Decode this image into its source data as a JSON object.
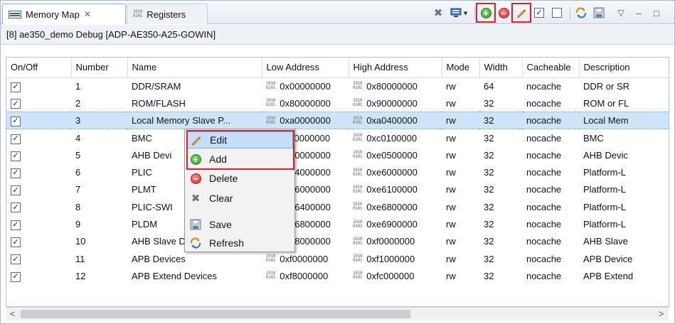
{
  "tabs": [
    {
      "label": "Memory Map",
      "close_glyph": "✕",
      "icon": "memory-map-icon",
      "active": true
    },
    {
      "label": "Registers",
      "icon": "registers-icon",
      "active": false
    }
  ],
  "debug_target": "[8] ae350_demo Debug [ADP-AE350-A25-GOWIN]",
  "binary_glyph": [
    "1010",
    "0101"
  ],
  "table": {
    "columns": [
      "On/Off",
      "Number",
      "Name",
      "Low Address",
      "High Address",
      "Mode",
      "Width",
      "Cacheable",
      "Description"
    ],
    "rows": [
      {
        "on": "☑",
        "number": "1",
        "name": "DDR/SRAM",
        "low": "0x00000000",
        "high": "0x80000000",
        "mode": "rw",
        "width": "64",
        "cache": "nocache",
        "desc": "DDR or SR"
      },
      {
        "on": "☑",
        "number": "2",
        "name": "ROM/FLASH",
        "low": "0x80000000",
        "high": "0x90000000",
        "mode": "rw",
        "width": "32",
        "cache": "nocache",
        "desc": "ROM or FL"
      },
      {
        "on": "☑",
        "number": "3",
        "name": "Local Memory Slave P...",
        "low": "0xa0000000",
        "high": "0xa0400000",
        "mode": "rw",
        "width": "32",
        "cache": "nocache",
        "desc": "Local Mem",
        "selected": true
      },
      {
        "on": "☑",
        "number": "4",
        "name": "BMC",
        "low": "0xc0000000",
        "high": "0xc0100000",
        "mode": "rw",
        "width": "32",
        "cache": "nocache",
        "desc": "BMC"
      },
      {
        "on": "☑",
        "number": "5",
        "name": "AHB Devi",
        "low": "0xe0000000",
        "high": "0xe0500000",
        "mode": "rw",
        "width": "32",
        "cache": "nocache",
        "desc": "AHB Devic"
      },
      {
        "on": "☑",
        "number": "6",
        "name": "PLIC",
        "low": "0xe4000000",
        "high": "0xe6000000",
        "mode": "rw",
        "width": "32",
        "cache": "nocache",
        "desc": "Platform-L"
      },
      {
        "on": "☑",
        "number": "7",
        "name": "PLMT",
        "low": "0xe6000000",
        "high": "0xe6100000",
        "mode": "rw",
        "width": "32",
        "cache": "nocache",
        "desc": "Platform-L"
      },
      {
        "on": "☑",
        "number": "8",
        "name": "PLIC-SWI",
        "low": "0xe6400000",
        "high": "0xe6800000",
        "mode": "rw",
        "width": "32",
        "cache": "nocache",
        "desc": "Platform-L"
      },
      {
        "on": "☑",
        "number": "9",
        "name": "PLDM",
        "low": "0xe6800000",
        "high": "0xe6900000",
        "mode": "rw",
        "width": "32",
        "cache": "nocache",
        "desc": "Platform-L"
      },
      {
        "on": "☑",
        "number": "10",
        "name": "AHB Slave Devices",
        "low": "0xe8000000",
        "high": "0xf0000000",
        "mode": "rw",
        "width": "32",
        "cache": "nocache",
        "desc": "AHB Slave"
      },
      {
        "on": "☑",
        "number": "11",
        "name": "APB Devices",
        "low": "0xf0000000",
        "high": "0xf1000000",
        "mode": "rw",
        "width": "32",
        "cache": "nocache",
        "desc": "APB Device"
      },
      {
        "on": "☑",
        "number": "12",
        "name": "APB Extend Devices",
        "low": "0xf8000000",
        "high": "0xfc000000",
        "mode": "rw",
        "width": "32",
        "cache": "nocache",
        "desc": "APB Extend"
      }
    ]
  },
  "context_menu": [
    {
      "label": "Edit",
      "icon": "pencil-icon",
      "highlighted": true
    },
    {
      "label": "Add",
      "icon": "add-icon"
    },
    {
      "label": "Delete",
      "icon": "delete-icon"
    },
    {
      "label": "Clear",
      "icon": "clear-icon"
    },
    {
      "label": "Save",
      "icon": "save-icon"
    },
    {
      "label": "Refresh",
      "icon": "refresh-icon"
    }
  ],
  "toolbar_glyphs": {
    "clear": "✖",
    "dropdown": "▾",
    "view_menu": "▽",
    "minimize": "–",
    "maximize": "□",
    "plus": "+",
    "minus": "−",
    "check": "✓",
    "scroll_left": "<",
    "scroll_right": ">"
  },
  "colors": {
    "accent_red": "#e0202a",
    "selection": "#cce5fb",
    "add_green": "#2f9a2a",
    "delete_red": "#d42a2a"
  }
}
